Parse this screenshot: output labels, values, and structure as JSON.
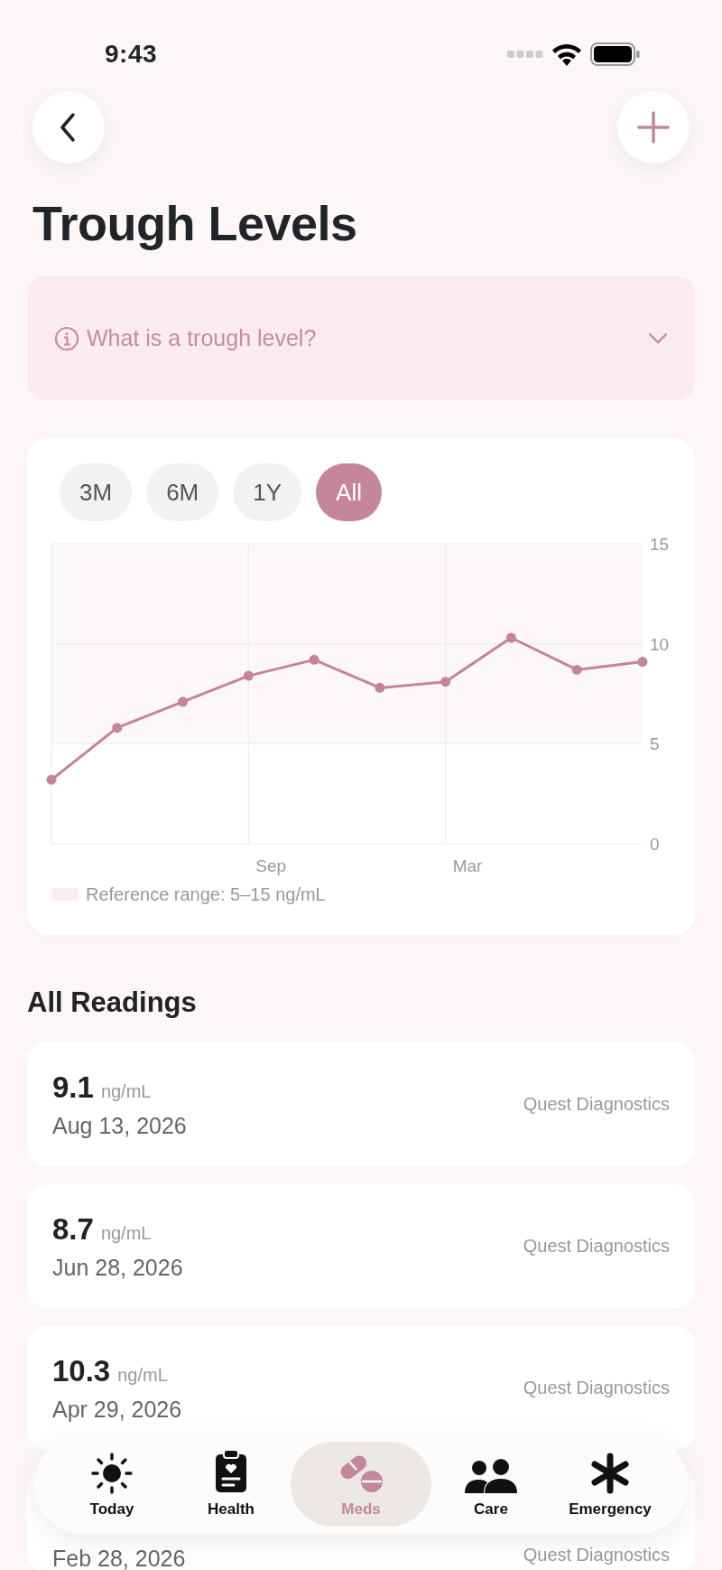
{
  "status_bar": {
    "time": "9:43"
  },
  "header": {
    "title": "Trough Levels"
  },
  "info": {
    "label": "What is a trough level?",
    "expanded": false
  },
  "range_tabs": [
    {
      "label": "3M",
      "selected": false
    },
    {
      "label": "6M",
      "selected": false
    },
    {
      "label": "1Y",
      "selected": false
    },
    {
      "label": "All",
      "selected": true
    }
  ],
  "chart": {
    "chart_data": {
      "type": "line",
      "categories": [
        null,
        null,
        null,
        "Sep",
        null,
        null,
        "Mar",
        null,
        null,
        null
      ],
      "series": [
        {
          "color": "#c8829a",
          "marker": true,
          "values": [
            3.2,
            5.8,
            7.1,
            8.4,
            9.2,
            7.8,
            8.1,
            10.3,
            8.7,
            9.1
          ]
        }
      ],
      "ylim": [
        0,
        15
      ],
      "yticks": [
        0,
        5,
        10,
        15
      ]
    },
    "legend": "Reference range: 5–15 ng/mL"
  },
  "readings_title": "All Readings",
  "readings": [
    {
      "value": "9.1",
      "unit": "ng/mL",
      "date": "Aug 13, 2026",
      "lab": "Quest Diagnostics"
    },
    {
      "value": "8.7",
      "unit": "ng/mL",
      "date": "Jun 28, 2026",
      "lab": "Quest Diagnostics"
    },
    {
      "value": "10.3",
      "unit": "ng/mL",
      "date": "Apr 29, 2026",
      "lab": "Quest Diagnostics"
    },
    {
      "date": "Feb 28, 2026",
      "lab": "Quest Diagnostics"
    }
  ],
  "tab_bar": [
    {
      "label": "Today",
      "selected": false
    },
    {
      "label": "Health",
      "selected": false
    },
    {
      "label": "Meds",
      "selected": true
    },
    {
      "label": "Care",
      "selected": false
    },
    {
      "label": "Emergency",
      "selected": false
    }
  ]
}
